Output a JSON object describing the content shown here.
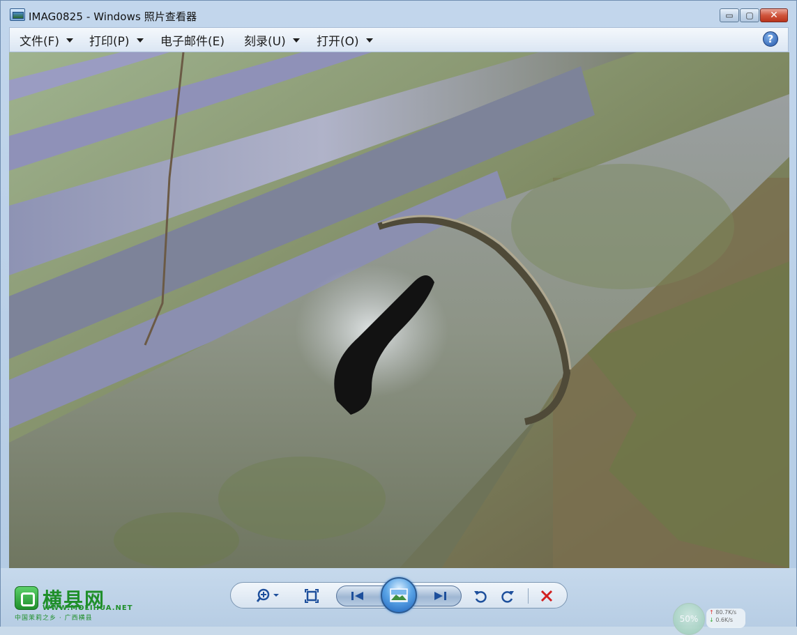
{
  "window": {
    "title": "IMAG0825 - Windows 照片查看器",
    "minimize_glyph": "▭",
    "maximize_glyph": "▢",
    "close_glyph": "✕"
  },
  "menu": {
    "items": [
      {
        "label": "文件(F)",
        "has_dropdown": true
      },
      {
        "label": "打印(P)",
        "has_dropdown": true
      },
      {
        "label": "电子邮件(E)",
        "has_dropdown": false
      },
      {
        "label": "刻录(U)",
        "has_dropdown": true
      },
      {
        "label": "打开(O)",
        "has_dropdown": true
      }
    ],
    "help_glyph": "?"
  },
  "photo": {
    "subject": "caterpillar-on-bamboo-photo"
  },
  "toolbar": {
    "buttons": [
      {
        "name": "zoom-button",
        "icon": "zoom-in-icon"
      },
      {
        "name": "actual-size-button",
        "icon": "fit-window-icon"
      },
      {
        "name": "previous-button",
        "icon": "previous-icon"
      },
      {
        "name": "slideshow-button",
        "icon": "slideshow-icon"
      },
      {
        "name": "next-button",
        "icon": "next-icon"
      },
      {
        "name": "rotate-left-button",
        "icon": "rotate-counterclockwise-icon"
      },
      {
        "name": "rotate-right-button",
        "icon": "rotate-clockwise-icon"
      },
      {
        "name": "delete-button",
        "icon": "delete-icon"
      }
    ],
    "colors": {
      "icon": "#1d4f9c",
      "delete": "#d21f1f"
    }
  },
  "watermark": {
    "title": "横县网",
    "url": "WWW.MOLIHUA.NET",
    "slogan": "中国茉莉之乡 · 广西横县"
  },
  "net_widget": {
    "percent": "50%",
    "upload": "80.7K/s",
    "download": "0.6K/s"
  }
}
